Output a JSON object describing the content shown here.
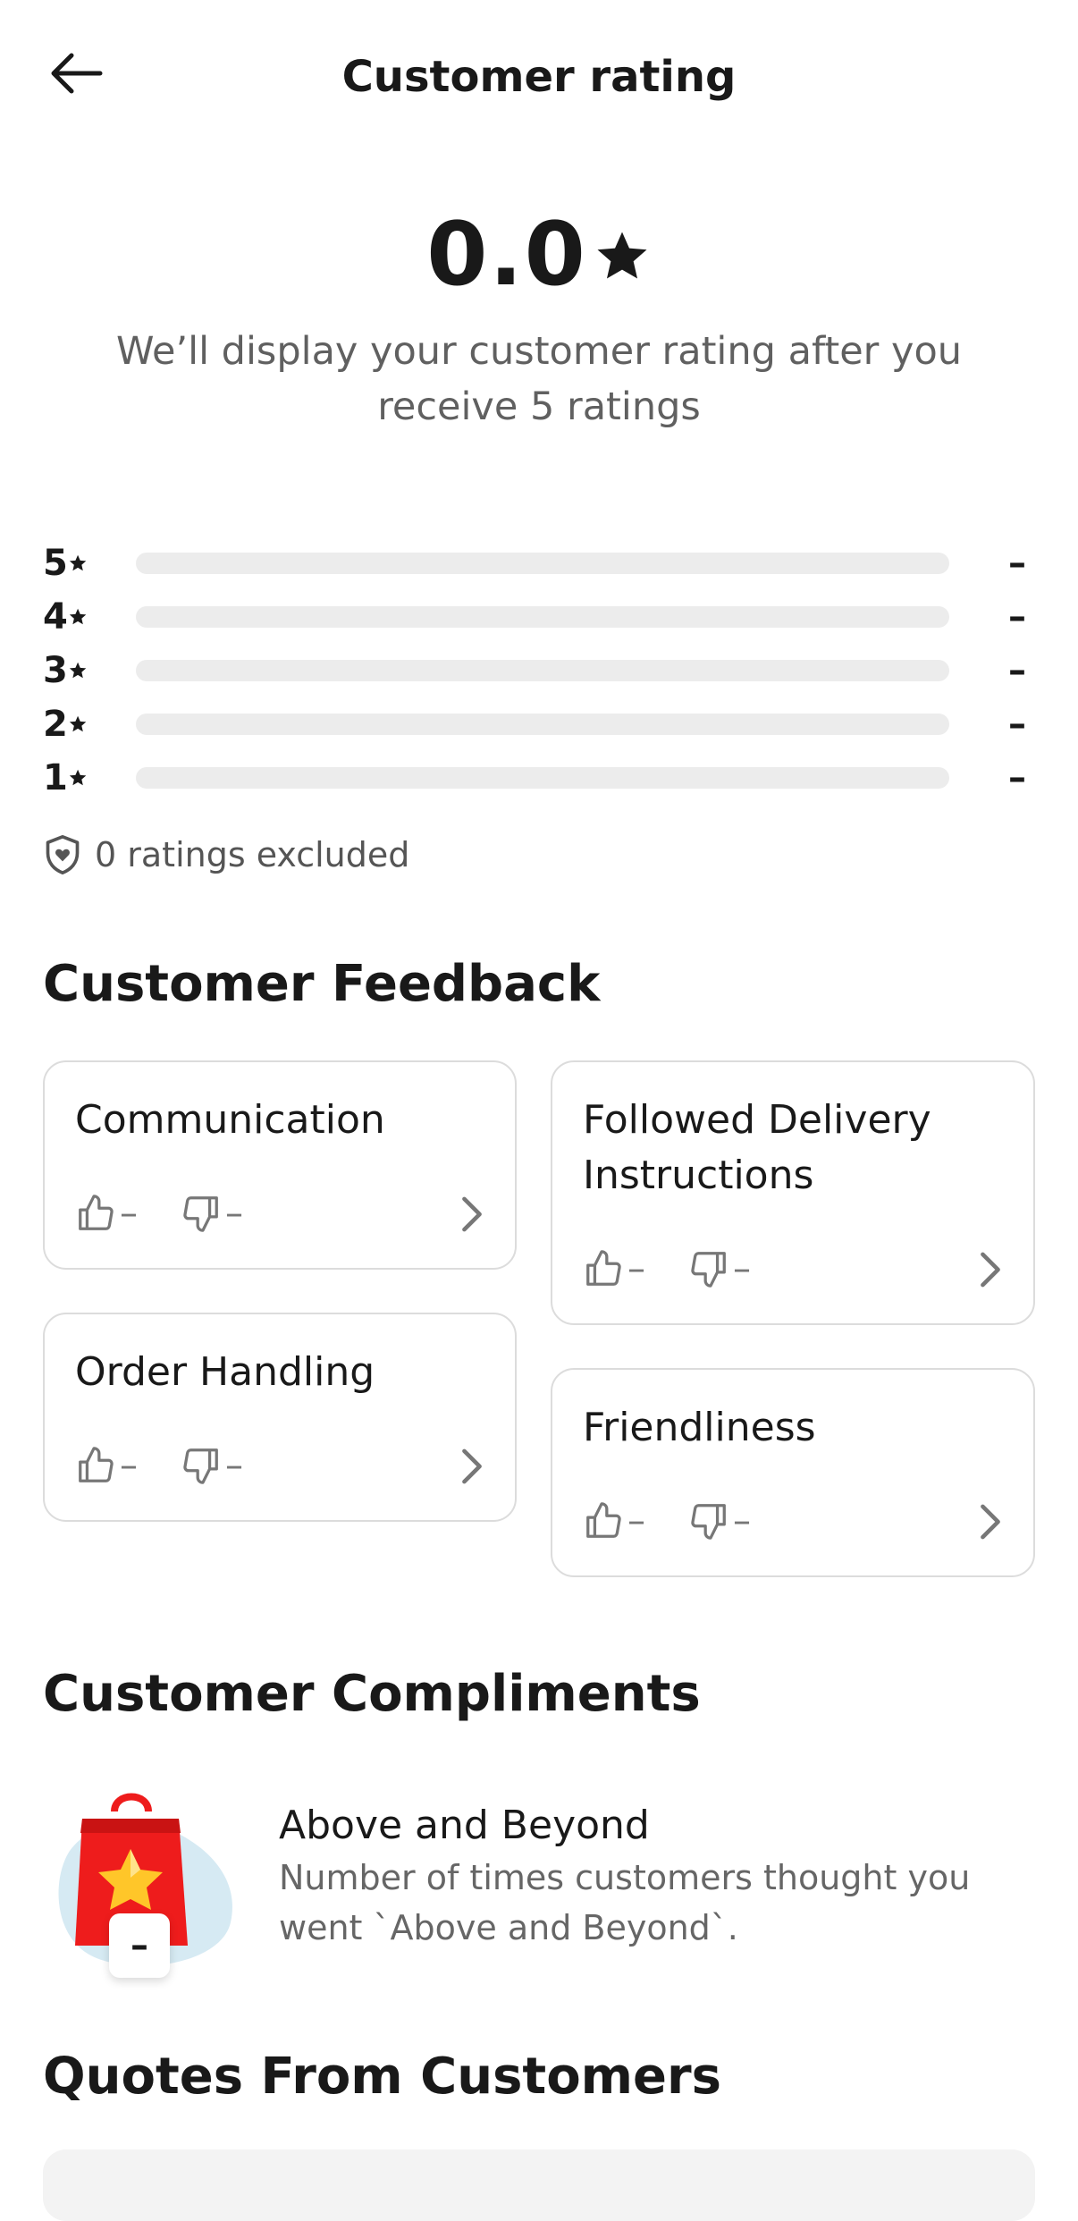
{
  "header": {
    "title": "Customer rating"
  },
  "rating": {
    "score": "0.0",
    "message": "We’ll display your customer rating after you receive 5 ratings"
  },
  "distribution": [
    {
      "stars": "5",
      "fraction": 0,
      "count": "–"
    },
    {
      "stars": "4",
      "fraction": 0,
      "count": "–"
    },
    {
      "stars": "3",
      "fraction": 0,
      "count": "–"
    },
    {
      "stars": "2",
      "fraction": 0,
      "count": "–"
    },
    {
      "stars": "1",
      "fraction": 0,
      "count": "–"
    }
  ],
  "excluded_text": "0 ratings excluded",
  "feedback": {
    "heading": "Customer Feedback",
    "cards": [
      {
        "title": "Communication",
        "up": "–",
        "down": "–"
      },
      {
        "title": "Followed Delivery Instructions",
        "up": "–",
        "down": "–"
      },
      {
        "title": "Order Handling",
        "up": "–",
        "down": "–"
      },
      {
        "title": "Friendliness",
        "up": "–",
        "down": "–"
      }
    ]
  },
  "compliments": {
    "heading": "Customer Compliments",
    "items": [
      {
        "title": "Above and Beyond",
        "description": "Number of times customers thought you went `Above and Beyond`.",
        "count": "–"
      }
    ]
  },
  "quotes": {
    "heading": "Quotes From Customers"
  },
  "colors": {
    "text": "#191919",
    "muted": "#606060",
    "bar_track": "#ececec",
    "bag_red": "#ee1c1c",
    "star_yellow": "#ffc629",
    "blob": "#d6eaf3"
  },
  "icons": [
    "back-arrow-icon",
    "star-icon",
    "shield-heart-icon",
    "thumbs-up-icon",
    "thumbs-down-icon",
    "chevron-right-icon",
    "shopping-bag-star-icon"
  ]
}
